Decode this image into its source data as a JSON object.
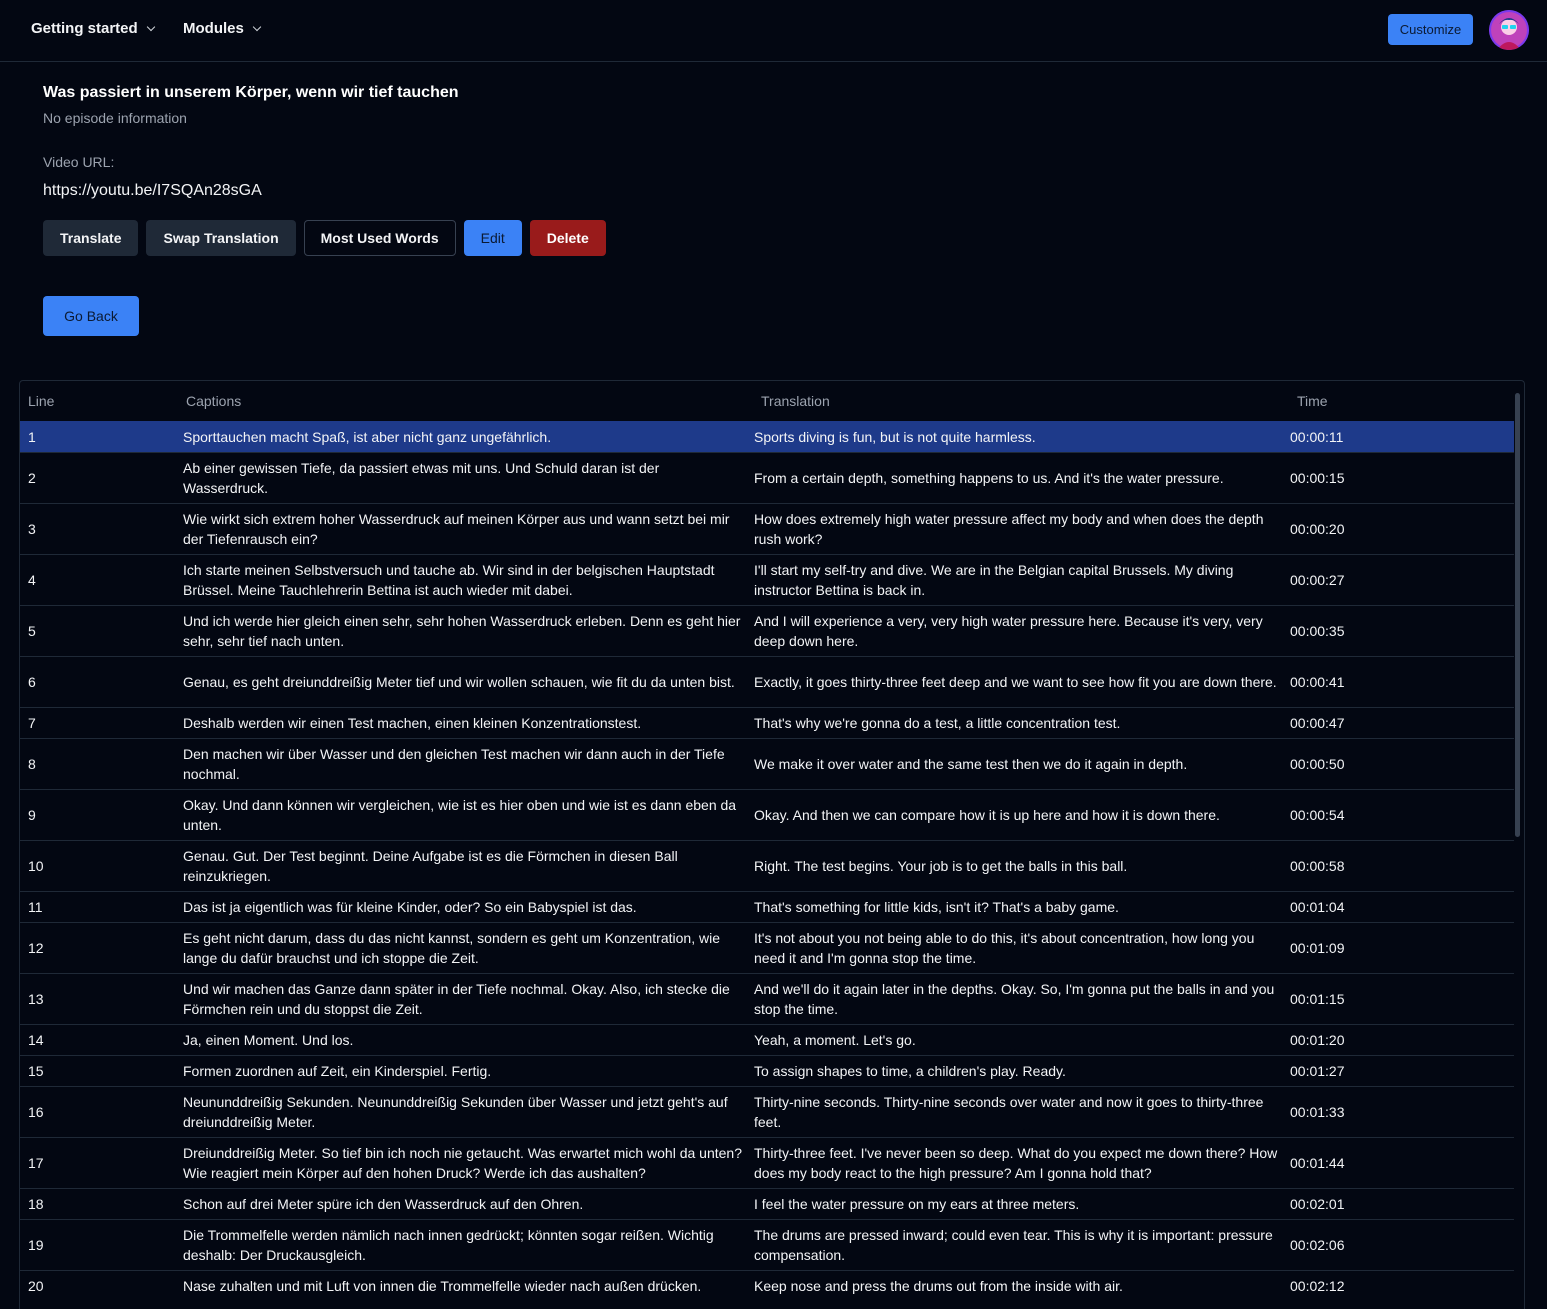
{
  "nav": {
    "getting_started": "Getting started",
    "modules": "Modules",
    "customize": "Customize"
  },
  "episode": {
    "title": "Was passiert in unserem Körper, wenn wir tief tauchen",
    "subtitle": "No episode information",
    "url_label": "Video URL:",
    "url": "https://youtu.be/I7SQAn28sGA"
  },
  "actions": {
    "translate": "Translate",
    "swap": "Swap Translation",
    "most_used": "Most Used Words",
    "edit": "Edit",
    "delete": "Delete",
    "go_back": "Go Back"
  },
  "colors": {
    "accent": "#3b82f6",
    "danger": "#991b1b",
    "selected_row": "#1e3a8a",
    "background": "#030712"
  },
  "table": {
    "headers": {
      "line": "Line",
      "captions": "Captions",
      "translation": "Translation",
      "time": "Time"
    },
    "selected_line": "1",
    "rows": [
      {
        "line": "1",
        "caption": "Sporttauchen macht Spaß, ist aber nicht ganz ungefährlich.",
        "translation": "Sports diving is fun, but is not quite harmless.",
        "time": "00:00:11"
      },
      {
        "line": "2",
        "caption": "Ab einer gewissen Tiefe, da passiert etwas mit uns. Und Schuld daran ist der Wasserdruck.",
        "translation": "From a certain depth, something happens to us. And it's the water pressure.",
        "time": "00:00:15"
      },
      {
        "line": "3",
        "caption": "Wie wirkt sich extrem hoher Wasserdruck auf meinen Körper aus und wann setzt bei mir der Tiefenrausch ein?",
        "translation": "How does extremely high water pressure affect my body and when does the depth rush work?",
        "time": "00:00:20"
      },
      {
        "line": "4",
        "caption": "Ich starte meinen Selbstversuch und tauche ab. Wir sind in der belgischen Hauptstadt Brüssel. Meine Tauchlehrerin Bettina ist auch wieder mit dabei.",
        "translation": "I'll start my self-try and dive. We are in the Belgian capital Brussels. My diving instructor Bettina is back in.",
        "time": "00:00:27"
      },
      {
        "line": "5",
        "caption": "Und ich werde hier gleich einen sehr, sehr hohen Wasserdruck erleben. Denn es geht hier sehr, sehr tief nach unten.",
        "translation": "And I will experience a very, very high water pressure here. Because it's very, very deep down here.",
        "time": "00:00:35"
      },
      {
        "line": "6",
        "caption": "Genau, es geht dreiunddreißig Meter tief und wir wollen schauen, wie fit du da unten bist.",
        "translation": "Exactly, it goes thirty-three feet deep and we want to see how fit you are down there.",
        "time": "00:00:41"
      },
      {
        "line": "7",
        "caption": "Deshalb werden wir einen Test machen, einen kleinen Konzentrationstest.",
        "translation": "That's why we're gonna do a test, a little concentration test.",
        "time": "00:00:47"
      },
      {
        "line": "8",
        "caption": "Den machen wir über Wasser und den gleichen Test machen wir dann auch in der Tiefe nochmal.",
        "translation": "We make it over water and the same test then we do it again in depth.",
        "time": "00:00:50"
      },
      {
        "line": "9",
        "caption": "Okay. Und dann können wir vergleichen, wie ist es hier oben und wie ist es dann eben da unten.",
        "translation": "Okay. And then we can compare how it is up here and how it is down there.",
        "time": "00:00:54"
      },
      {
        "line": "10",
        "caption": "Genau. Gut. Der Test beginnt. Deine Aufgabe ist es die Förmchen in diesen Ball reinzukriegen.",
        "translation": "Right. The test begins. Your job is to get the balls in this ball.",
        "time": "00:00:58"
      },
      {
        "line": "11",
        "caption": "Das ist ja eigentlich was für kleine Kinder, oder? So ein Babyspiel ist das.",
        "translation": "That's something for little kids, isn't it? That's a baby game.",
        "time": "00:01:04"
      },
      {
        "line": "12",
        "caption": "Es geht nicht darum, dass du das nicht kannst, sondern es geht um Konzentration, wie lange du dafür brauchst und ich stoppe die Zeit.",
        "translation": "It's not about you not being able to do this, it's about concentration, how long you need it and I'm gonna stop the time.",
        "time": "00:01:09"
      },
      {
        "line": "13",
        "caption": "Und wir machen das Ganze dann später in der Tiefe nochmal. Okay. Also, ich stecke die Förmchen rein und du stoppst die Zeit.",
        "translation": "And we'll do it again later in the depths. Okay. So, I'm gonna put the balls in and you stop the time.",
        "time": "00:01:15"
      },
      {
        "line": "14",
        "caption": "Ja, einen Moment. Und los.",
        "translation": "Yeah, a moment. Let's go.",
        "time": "00:01:20"
      },
      {
        "line": "15",
        "caption": "Formen zuordnen auf Zeit, ein Kinderspiel. Fertig.",
        "translation": "To assign shapes to time, a children's play. Ready.",
        "time": "00:01:27"
      },
      {
        "line": "16",
        "caption": "Neununddreißig Sekunden. Neununddreißig Sekunden über Wasser und jetzt geht's auf dreiunddreißig Meter.",
        "translation": "Thirty-nine seconds. Thirty-nine seconds over water and now it goes to thirty-three feet.",
        "time": "00:01:33"
      },
      {
        "line": "17",
        "caption": "Dreiunddreißig Meter. So tief bin ich noch nie getaucht. Was erwartet mich wohl da unten? Wie reagiert mein Körper auf den hohen Druck? Werde ich das aushalten?",
        "translation": "Thirty-three feet. I've never been so deep. What do you expect me down there? How does my body react to the high pressure? Am I gonna hold that?",
        "time": "00:01:44"
      },
      {
        "line": "18",
        "caption": "Schon auf drei Meter spüre ich den Wasserdruck auf den Ohren.",
        "translation": "I feel the water pressure on my ears at three meters.",
        "time": "00:02:01"
      },
      {
        "line": "19",
        "caption": "Die Trommelfelle werden nämlich nach innen gedrückt; könnten sogar reißen. Wichtig deshalb: Der Druckausgleich.",
        "translation": "The drums are pressed inward; could even tear. This is why it is important: pressure compensation.",
        "time": "00:02:06"
      },
      {
        "line": "20",
        "caption": "Nase zuhalten und mit Luft von innen die Trommelfelle wieder nach außen drücken.",
        "translation": "Keep nose and press the drums out from the inside with air.",
        "time": "00:02:12"
      }
    ]
  }
}
